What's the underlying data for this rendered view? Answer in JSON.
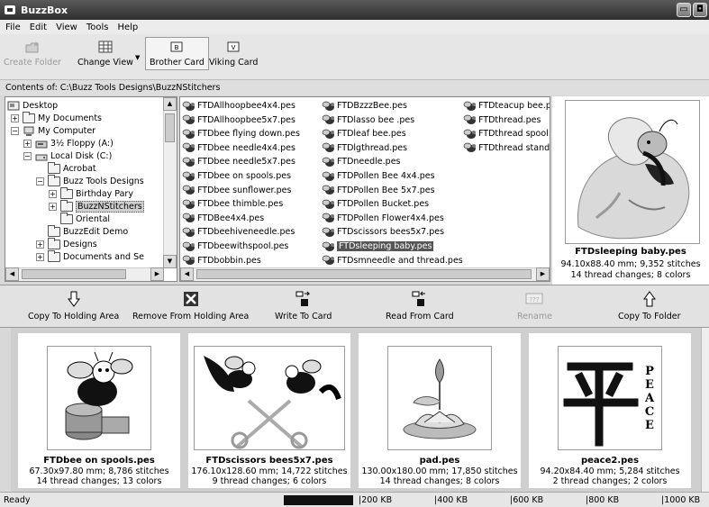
{
  "window": {
    "title": "BuzzBox",
    "buttons": [
      "minimize",
      "maximize"
    ]
  },
  "menu": [
    "File",
    "Edit",
    "View",
    "Tools",
    "Help"
  ],
  "toolbar": {
    "create_folder": "Create Folder",
    "change_view": "Change View",
    "brother_card": "Brother Card",
    "viking_card": "Viking Card"
  },
  "path": "Contents of: C:\\Buzz Tools Designs\\BuzzNStitchers",
  "tree": {
    "desktop": "Desktop",
    "my_documents": "My Documents",
    "my_computer": "My Computer",
    "floppy": "3½ Floppy (A:)",
    "local_disk": "Local Disk (C:)",
    "acrobat": "Acrobat",
    "buzz_tools": "Buzz Tools Designs",
    "birthday": "Birthday Pary",
    "buzznstitchers": "BuzzNStitchers",
    "oriental": "Oriental",
    "buzzedit": "BuzzEdit Demo",
    "designs": "Designs",
    "docs_settings": "Documents and Se"
  },
  "files": [
    [
      "FTDAllhoopbee4x4.pes",
      "FTDAllhoopbee5x7.pes",
      "FTDbee flying down.pes",
      "FTDbee needle4x4.pes",
      "FTDbee needle5x7.pes",
      "FTDbee on spools.pes",
      "FTDbee sunflower.pes",
      "FTDbee thimble.pes",
      "FTDBee4x4.pes",
      "FTDbeehiveneedle.pes",
      "FTDbeewithspool.pes",
      "FTDbobbin.pes"
    ],
    [
      "FTDBzzzBee.pes",
      "FTDlasso bee .pes",
      "FTDleaf bee.pes",
      "FTDlgthread.pes",
      "FTDneedle.pes",
      "FTDPollen Bee 4x4.pes",
      "FTDPollen Bee 5x7.pes",
      "FTDPollen Bucket.pes",
      "FTDPollen Flower4x4.pes",
      "FTDscissors bees5x7.pes",
      "FTDsleeping baby.pes",
      "FTDsmneedle and thread.pes"
    ],
    [
      "FTDteacup bee.pes",
      "FTDthread.pes",
      "FTDthread spool.pes",
      "FTDthread stand.pes"
    ]
  ],
  "selected_file": "FTDsleeping baby.pes",
  "preview": {
    "name": "FTDsleeping baby.pes",
    "size": "94.10x88.40 mm; 9,352 stitches",
    "changes": "14 thread changes; 8 colors"
  },
  "actions": {
    "copy_holding": "Copy To Holding Area",
    "remove_holding": "Remove From Holding Area",
    "write_card": "Write To Card",
    "read_card": "Read From Card",
    "rename": "Rename",
    "copy_folder": "Copy To Folder"
  },
  "holding": [
    {
      "name": "FTDbee on spools.pes",
      "size": "67.30x97.80 mm; 8,786 stitches",
      "changes": "14 thread changes; 13 colors"
    },
    {
      "name": "FTDscissors bees5x7.pes",
      "size": "176.10x128.60 mm; 14,722 stitches",
      "changes": "9 thread changes; 6 colors"
    },
    {
      "name": "pad.pes",
      "size": "130.00x180.00 mm; 17,850 stitches",
      "changes": "14 thread changes; 8 colors"
    },
    {
      "name": "peace2.pes",
      "size": "94.20x84.40 mm; 5,284 stitches",
      "changes": "2 thread changes; 2 colors"
    }
  ],
  "peace_letters": [
    "P",
    "E",
    "A",
    "C",
    "E"
  ],
  "status": {
    "text": "Ready",
    "capacity_fraction": 0.1,
    "marks": [
      "200 KB",
      "400 KB",
      "600 KB",
      "800 KB",
      "1000 KB"
    ]
  }
}
